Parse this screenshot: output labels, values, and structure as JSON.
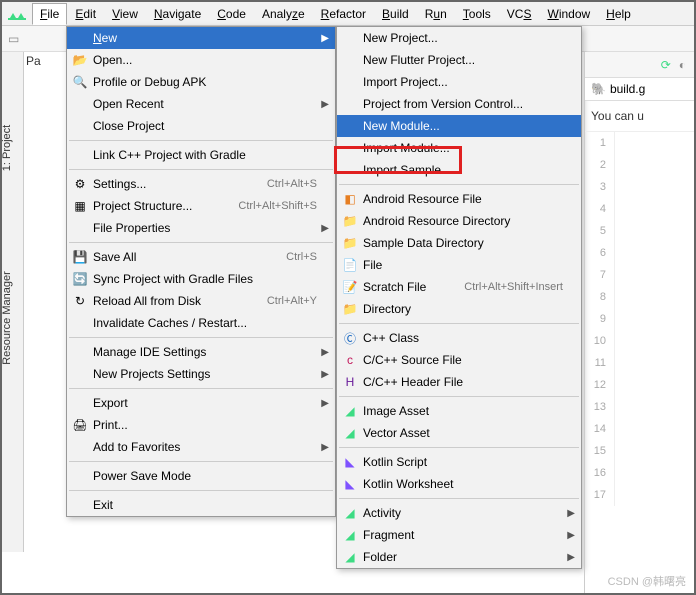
{
  "menubar": [
    "File",
    "Edit",
    "View",
    "Navigate",
    "Code",
    "Analyze",
    "Refactor",
    "Build",
    "Run",
    "Tools",
    "VCS",
    "Window",
    "Help"
  ],
  "activeMenu": "File",
  "sidebar": {
    "project": "1: Project",
    "resmgr": "Resource Manager"
  },
  "paneTitle": "Pa",
  "fileMenu": {
    "new": "New",
    "open": "Open...",
    "profile": "Profile or Debug APK",
    "openRecent": "Open Recent",
    "closeProject": "Close Project",
    "linkCpp": "Link C++ Project with Gradle",
    "settings": {
      "label": "Settings...",
      "sc": "Ctrl+Alt+S"
    },
    "projStruct": {
      "label": "Project Structure...",
      "sc": "Ctrl+Alt+Shift+S"
    },
    "fileProps": "File Properties",
    "saveAll": {
      "label": "Save All",
      "sc": "Ctrl+S"
    },
    "sync": "Sync Project with Gradle Files",
    "reload": {
      "label": "Reload All from Disk",
      "sc": "Ctrl+Alt+Y"
    },
    "invalidate": "Invalidate Caches / Restart...",
    "manageIde": "Manage IDE Settings",
    "newProjSettings": "New Projects Settings",
    "export": "Export",
    "print": "Print...",
    "addFav": "Add to Favorites",
    "powerSave": "Power Save Mode",
    "exit": "Exit"
  },
  "newMenu": {
    "newProject": "New Project...",
    "newFlutter": "New Flutter Project...",
    "importProject": "Import Project...",
    "fromVcs": "Project from Version Control...",
    "newModule": "New Module...",
    "importModule": "Import Module...",
    "importSample": "Import Sample...",
    "androidResFile": "Android Resource File",
    "androidResDir": "Android Resource Directory",
    "sampleDataDir": "Sample Data Directory",
    "file": "File",
    "scratch": {
      "label": "Scratch File",
      "sc": "Ctrl+Alt+Shift+Insert"
    },
    "directory": "Directory",
    "cppClass": "C++ Class",
    "cppSource": "C/C++ Source File",
    "cppHeader": "C/C++ Header File",
    "imageAsset": "Image Asset",
    "vectorAsset": "Vector Asset",
    "kotlinScript": "Kotlin Script",
    "kotlinWorksheet": "Kotlin Worksheet",
    "activity": "Activity",
    "fragment": "Fragment",
    "folder": "Folder"
  },
  "editor": {
    "tab": "build.g",
    "msg": "You can u",
    "lines": [
      "1",
      "2",
      "3",
      "4",
      "5",
      "6",
      "7",
      "8",
      "9",
      "10",
      "11",
      "12",
      "13",
      "14",
      "15",
      "16",
      "17"
    ]
  },
  "watermark": "CSDN @韩曙亮"
}
